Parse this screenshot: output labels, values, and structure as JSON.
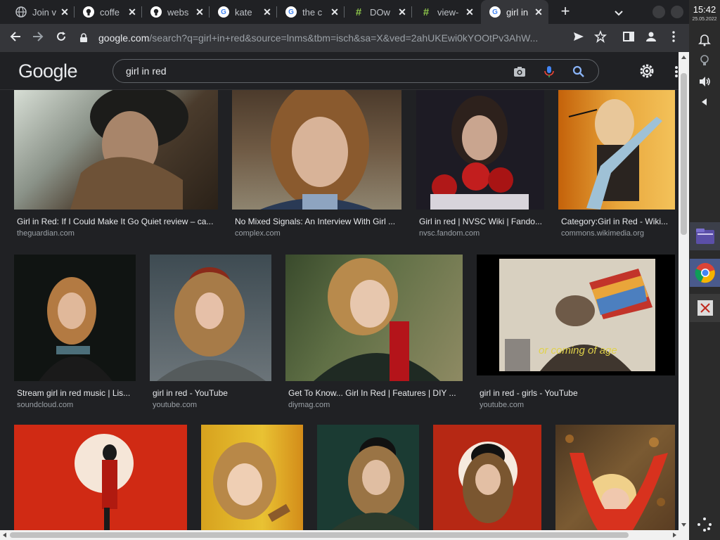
{
  "tabs": [
    {
      "title": "Join v",
      "favicon": "globe-icon",
      "color": "#9aa0a6"
    },
    {
      "title": "coffe",
      "favicon": "github-icon",
      "color": "#ffffff"
    },
    {
      "title": "webs",
      "favicon": "github-icon",
      "color": "#ffffff"
    },
    {
      "title": "kate",
      "favicon": "google-g-icon",
      "color": "#4285f4"
    },
    {
      "title": "the c",
      "favicon": "google-g-icon",
      "color": "#4285f4"
    },
    {
      "title": "DOw",
      "favicon": "hash-icon",
      "color": "#8bc34a"
    },
    {
      "title": "view-",
      "favicon": "hash-icon",
      "color": "#8bc34a"
    },
    {
      "title": "girl in",
      "favicon": "google-g-icon",
      "color": "#4285f4",
      "active": true
    }
  ],
  "toolbar": {
    "url_domain": "google.com",
    "url_path": "/search?q=girl+in+red&source=lnms&tbm=isch&sa=X&ved=2ahUKEwi0kYOOtPv3AhW..."
  },
  "google": {
    "logo": "Google",
    "query": "girl in red"
  },
  "results": [
    {
      "caption": "Girl in Red: If I Could Make It Go Quiet review – ca...",
      "source": "theguardian.com"
    },
    {
      "caption": "No Mixed Signals: An Interview With Girl ...",
      "source": "complex.com"
    },
    {
      "caption": "Girl in red | NVSC Wiki | Fando...",
      "source": "nvsc.fandom.com"
    },
    {
      "caption": "Category:Girl in Red - Wiki...",
      "source": "commons.wikimedia.org"
    },
    {
      "caption": "Stream girl in red music | Lis...",
      "source": "soundcloud.com"
    },
    {
      "caption": "girl in red - YouTube",
      "source": "youtube.com"
    },
    {
      "caption": "Get To Know... Girl In Red | Features | DIY ...",
      "source": "diymag.com"
    },
    {
      "caption": "girl in red - girls - YouTube",
      "source": "youtube.com",
      "overlay": "or coming of age"
    },
    {
      "caption": "",
      "source": ""
    },
    {
      "caption": "",
      "source": ""
    },
    {
      "caption": "",
      "source": ""
    },
    {
      "caption": "",
      "source": ""
    },
    {
      "caption": "",
      "source": ""
    }
  ],
  "shelf": {
    "time": "15:42",
    "date": "25.05.2022"
  },
  "colors": {
    "bg": "#202124",
    "toolbar": "#35363a",
    "accent_blue": "#8ab4f8"
  }
}
